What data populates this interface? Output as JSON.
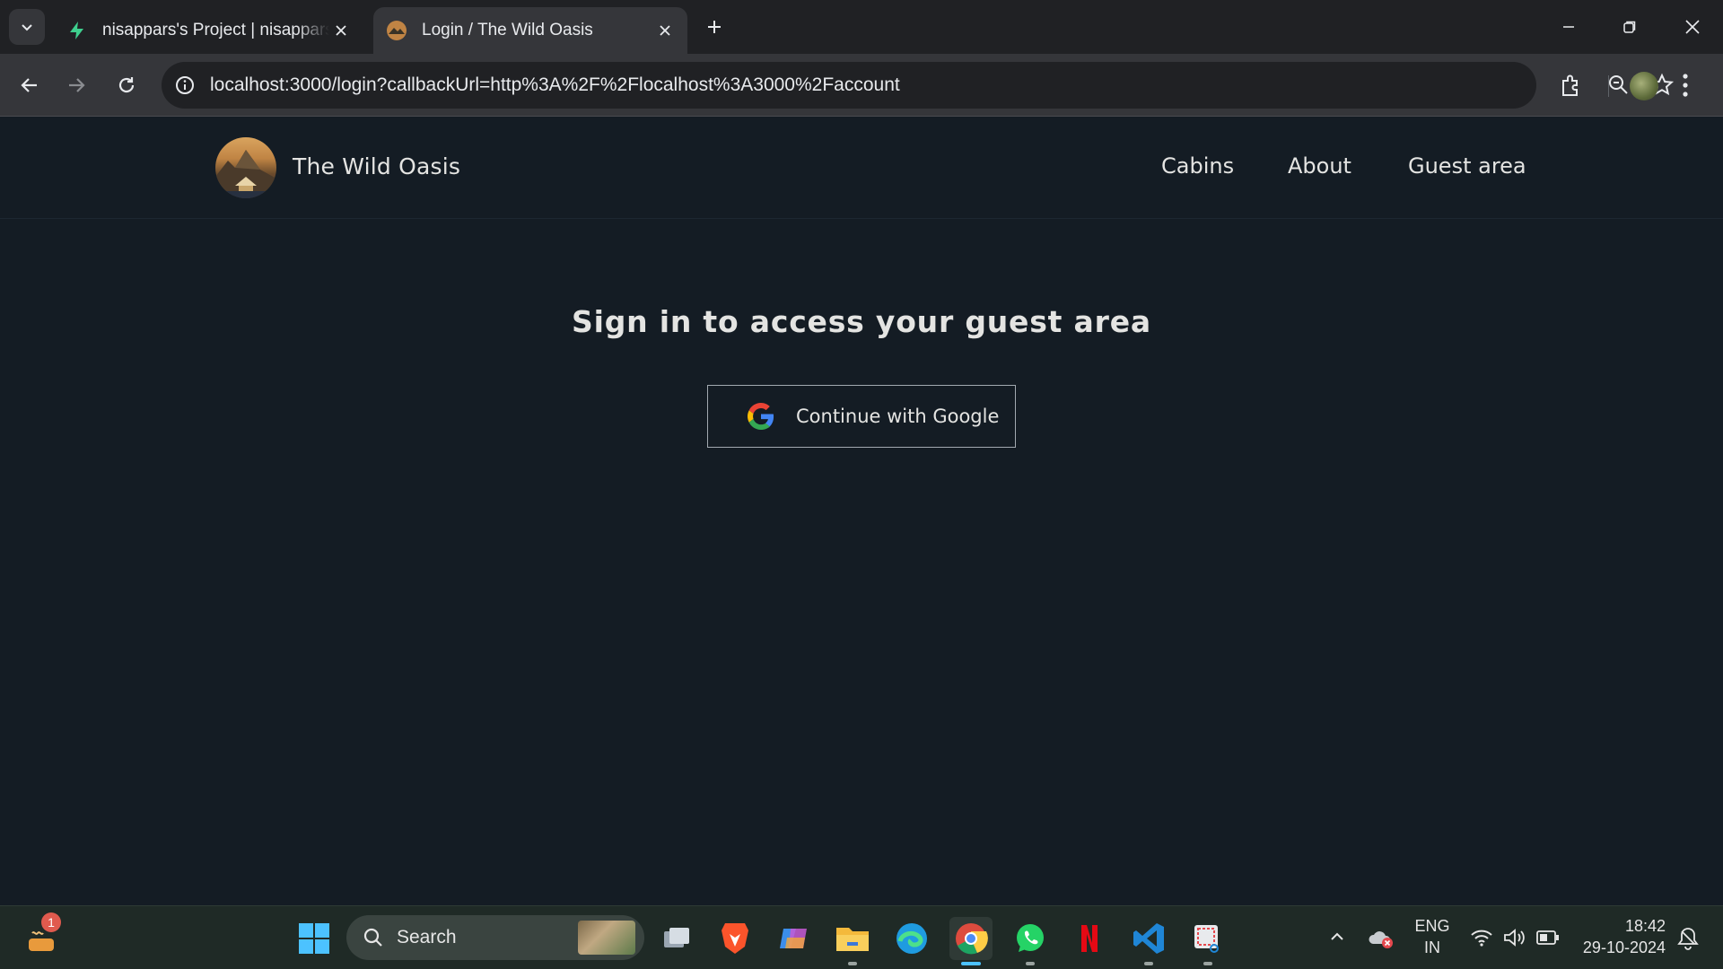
{
  "browser": {
    "tabs": [
      {
        "title": "nisappars's Project | nisappars's",
        "active": false
      },
      {
        "title": "Login / The Wild Oasis",
        "active": true
      }
    ],
    "url_host": "localhost",
    "url_rest": ":3000/login?callbackUrl=http%3A%2F%2Flocalhost%3A3000%2Faccount"
  },
  "site": {
    "name": "The Wild Oasis",
    "nav": {
      "cabins": "Cabins",
      "about": "About",
      "guest": "Guest area"
    }
  },
  "login": {
    "heading": "Sign in to access your guest area",
    "google_button": "Continue with Google"
  },
  "taskbar": {
    "search_label": "Search",
    "notification_count": "1",
    "lang_top": "ENG",
    "lang_bottom": "IN",
    "time": "18:42",
    "date": "29-10-2024"
  },
  "colors": {
    "page_bg": "#141c24",
    "text": "#e4e4e2",
    "button_border": "#a2a9b0",
    "taskbar_bg": "#1f2a26"
  }
}
